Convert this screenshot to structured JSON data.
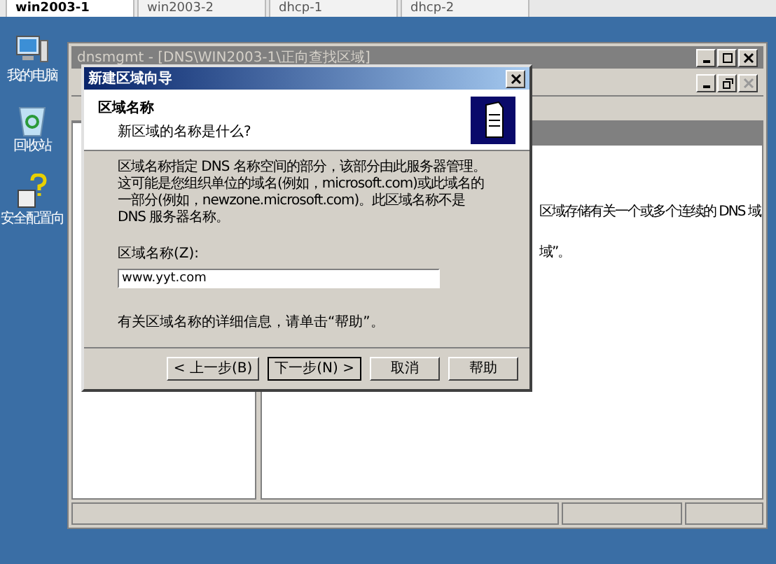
{
  "browser_tabs": [
    {
      "label": "win2003-1",
      "selected": true
    },
    {
      "label": "win2003-2",
      "selected": false
    },
    {
      "label": "dhcp-1",
      "selected": false
    },
    {
      "label": "dhcp-2",
      "selected": false
    }
  ],
  "desktop_icons": [
    {
      "label": "我的电脑",
      "kind": "computer"
    },
    {
      "label": "回收站",
      "kind": "recycle"
    },
    {
      "label": "安全配置向",
      "kind": "wizard"
    }
  ],
  "mmc": {
    "title": "dnsmgmt - [DNS\\WIN2003-1\\正向查找区域]",
    "right_pane_lines": [
      "区域存储有关一个或多个连续的 DNS 域",
      "域”。"
    ]
  },
  "dialog": {
    "title": "新建区域向导",
    "header_title": "区域名称",
    "header_subtitle": "新区域的名称是什么?",
    "description": "区域名称指定 DNS 名称空间的部分，该部分由此服务器管理。这可能是您组织单位的域名(例如，microsoft.com)或此域名的一部分(例如，newzone.microsoft.com)。此区域名称不是 DNS 服务器名称。",
    "field_label": "区域名称(Z):",
    "field_value": "www.yyt.com",
    "help_note": "有关区域名称的详细信息，请单击“帮助”。",
    "buttons": [
      {
        "label": "< 上一步(B)",
        "default": false
      },
      {
        "label": "下一步(N) >",
        "default": true
      },
      {
        "label": "取消",
        "default": false
      },
      {
        "label": "帮助",
        "default": false
      }
    ]
  }
}
